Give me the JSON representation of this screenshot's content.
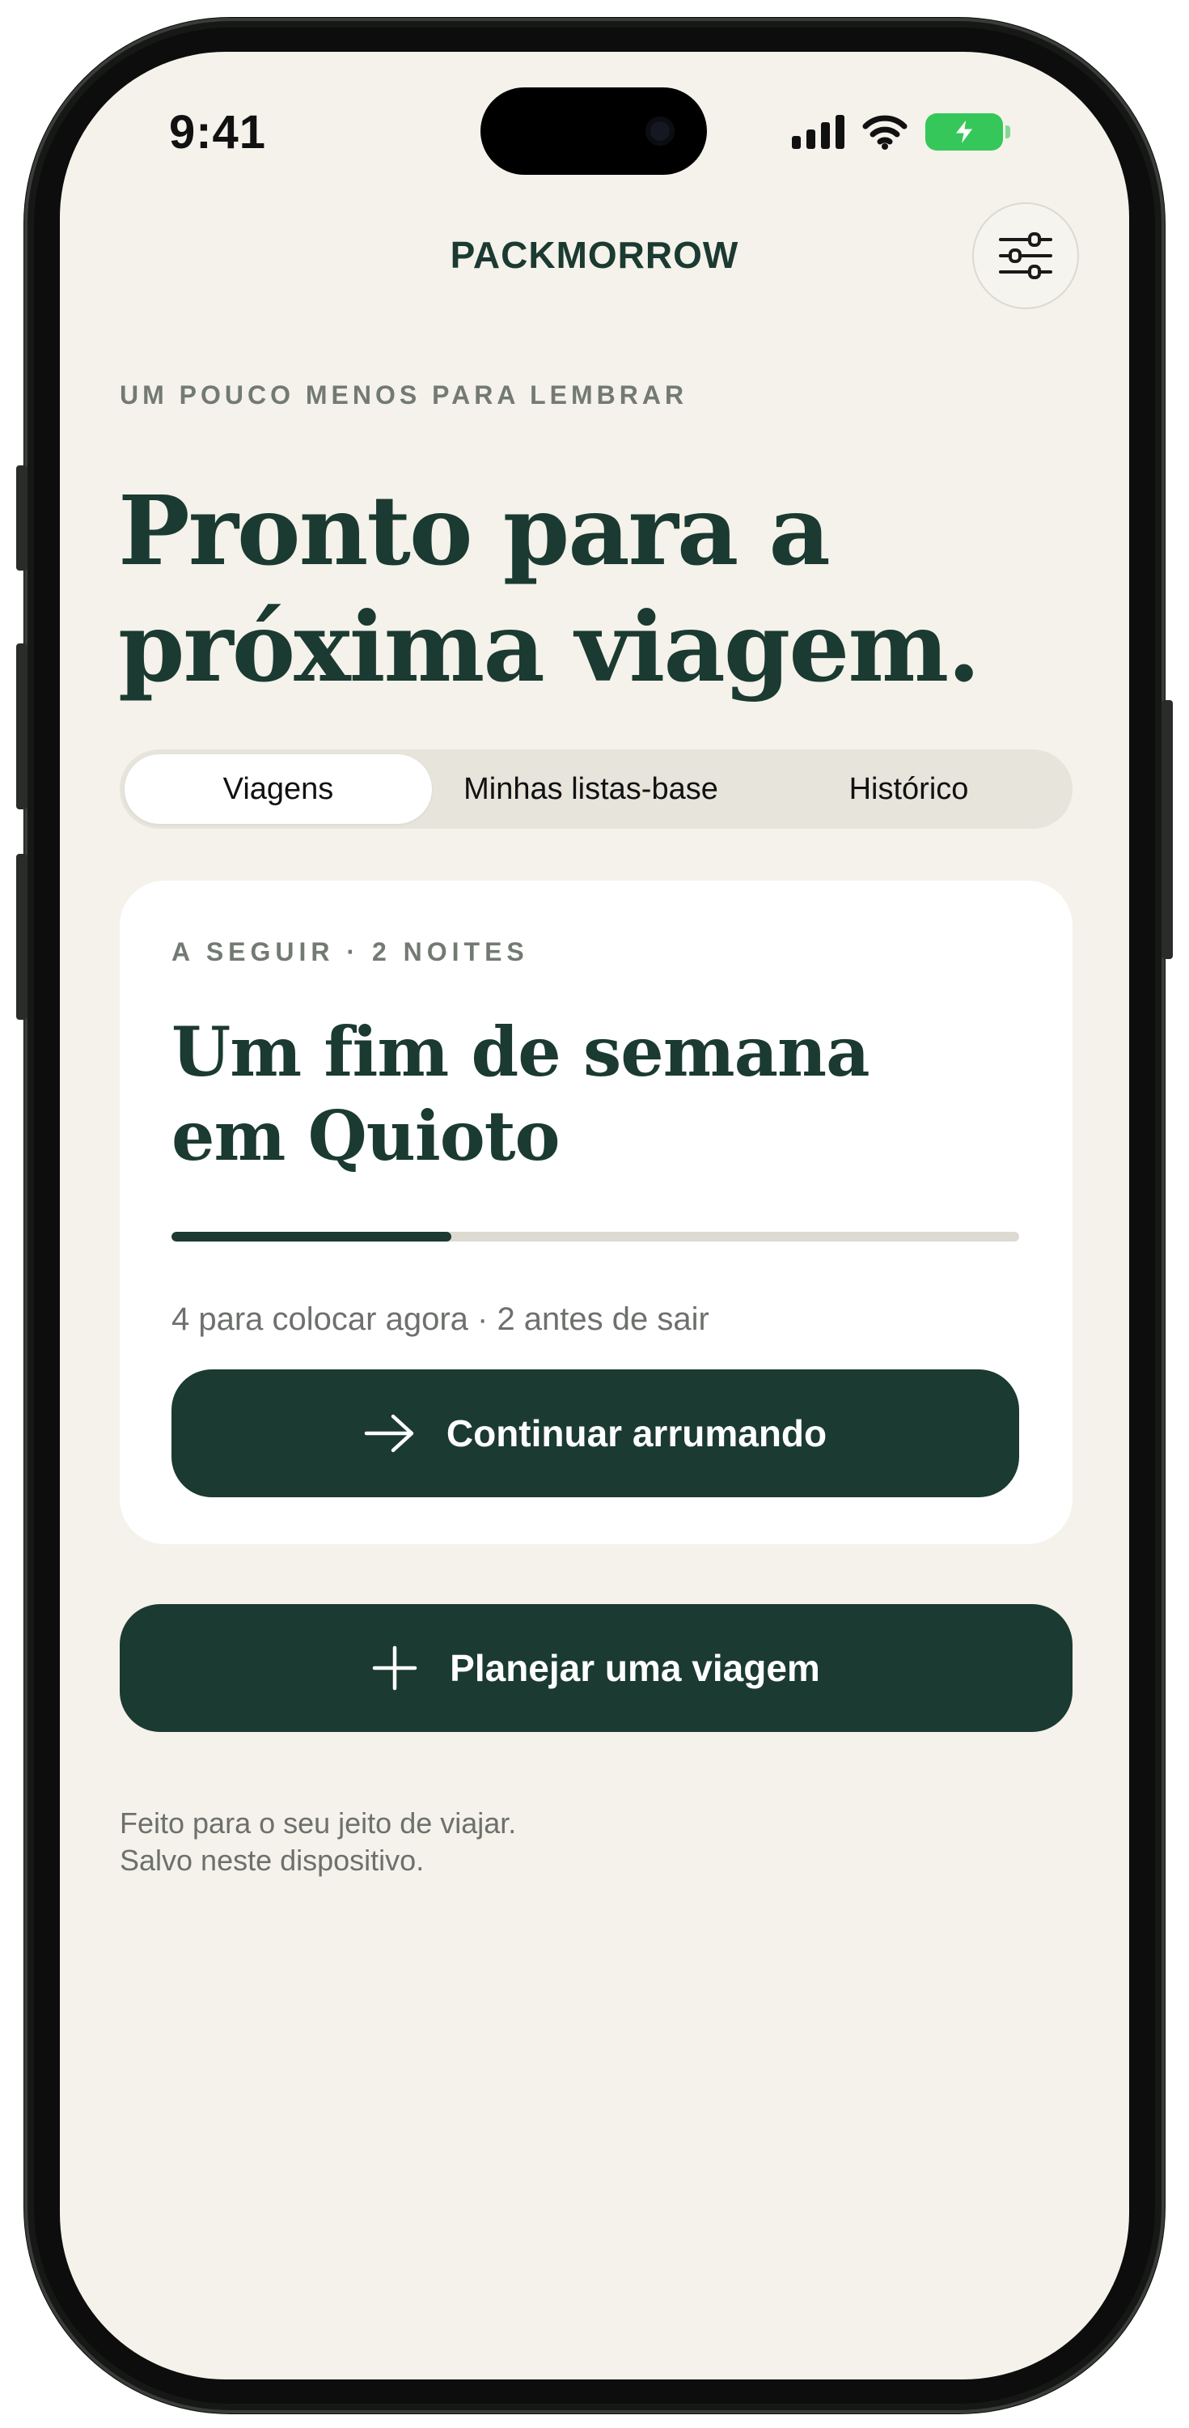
{
  "status_bar": {
    "time": "9:41",
    "icons": [
      "cellular-signal-icon",
      "wifi-icon",
      "battery-charging-icon"
    ],
    "battery_color": "#35c759"
  },
  "header": {
    "brand": "PACKMORROW",
    "settings_icon": "sliders-icon"
  },
  "hero": {
    "eyebrow": "UM POUCO MENOS PARA LEMBRAR",
    "headline_line1": "Pronto para a",
    "headline_line2": "próxima viagem."
  },
  "tabs": [
    {
      "label": "Viagens",
      "active": true
    },
    {
      "label": "Minhas listas-base",
      "active": false
    },
    {
      "label": "Histórico",
      "active": false
    }
  ],
  "trip_card": {
    "eyebrow": "A SEGUIR · 2 NOITES",
    "title_line1": "Um fim de semana",
    "title_line2": "em Quioto",
    "progress": 0.33,
    "summary": "4 para colocar agora · 2 antes de sair",
    "continue_label": "Continuar arrumando",
    "continue_icon": "arrow-right-icon"
  },
  "plan_button": {
    "label": "Planejar uma viagem",
    "icon": "plus-icon"
  },
  "footer": {
    "line1": "Feito para o seu jeito de viajar.",
    "line2": "Salvo neste dispositivo."
  },
  "colors": {
    "brand_green": "#1b3a31",
    "background": "#f4f2ea",
    "muted_text": "#6d706d"
  }
}
